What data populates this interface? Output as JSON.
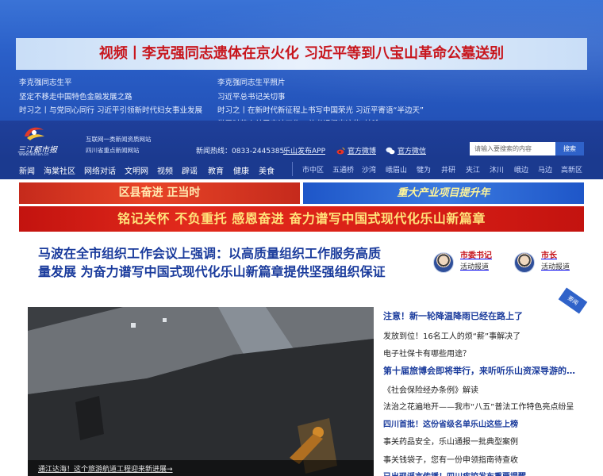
{
  "headline_banner": {
    "text": "视频丨李克强同志遗体在京火化 习近平等到八宝山革命公墓送别"
  },
  "sub_links": [
    "李克强同志生平",
    "李克强同志生平照片",
    "坚定不移走中国特色金融发展之路",
    "习近平总书记关切事",
    "时习之丨与党同心同行 习近平引领新时代妇女事业发展",
    "时习之丨在新时代新征程上书写中国荣光 习近平寄语“半边天”",
    "学习时节丨关于审计工作，总书记提出这些“妙喻”"
  ],
  "header": {
    "logo_text": "三江都市报",
    "logo_url": "www.leshan.cn",
    "site_desc_line1": "互联网一类新闻资质网站",
    "site_desc_line2": "四川省重点新闻网站",
    "hotline": "新闻热线：0833-2445385",
    "app_label": "乐山发布APP",
    "weibo_label": "官方微博",
    "wechat_label": "官方微信",
    "search_placeholder": "请输入要搜索的内容",
    "search_button": "搜索"
  },
  "nav": {
    "items": [
      "新闻",
      "海棠社区",
      "网络对话",
      "文明网",
      "视频",
      "辟谣",
      "教育",
      "健康",
      "美食"
    ],
    "counties": [
      "市中区",
      "五通桥",
      "沙湾",
      "峨眉山",
      "犍为",
      "井研",
      "夹江",
      "沐川",
      "峨边",
      "马边",
      "高新区"
    ]
  },
  "banners": {
    "left": "区县奋进 正当时",
    "right": "重大产业项目提升年",
    "wide": "铭记关怀 不负重托 感恩奋进 奋力谱写中国式现代化乐山新篇章"
  },
  "main_headline": "马波在全市组织工作会议上强调：以高质量组织工作服务高质量发展 为奋力谱写中国式现代化乐山新篇章提供坚强组织保证",
  "leaders": [
    {
      "title": "市委书记",
      "sub": "活动报道"
    },
    {
      "title": "市长",
      "sub": "活动报道"
    }
  ],
  "photo_caption": "通江达海！这个旅游航道工程迎来新进展→",
  "corner_tag": "要闻",
  "news": [
    "注意！新一轮降温降雨已经在路上了",
    "发放到位！16名工人的烦“薪”事解决了",
    "电子社保卡有哪些用途？",
    "第十届旅博会即将举行，来听听乐山资深导游的…",
    "《社会保险经办条例》解读",
    "法治之花遍地开——我市“八五”普法工作特色亮点纷呈",
    "四川首批！这份省级名单乐山这些上榜",
    "事关药品安全，乐山通报一批典型案例",
    "事关钱袋子，您有一份申领指南待查收",
    "已出现谣言传播！四川疾控发布重要提醒"
  ],
  "colors": {
    "top_band": "#2a5fc8",
    "header_navy": "#1b3a8f",
    "accent_red": "#c8161d",
    "headline_blue": "#1a3b9c"
  }
}
